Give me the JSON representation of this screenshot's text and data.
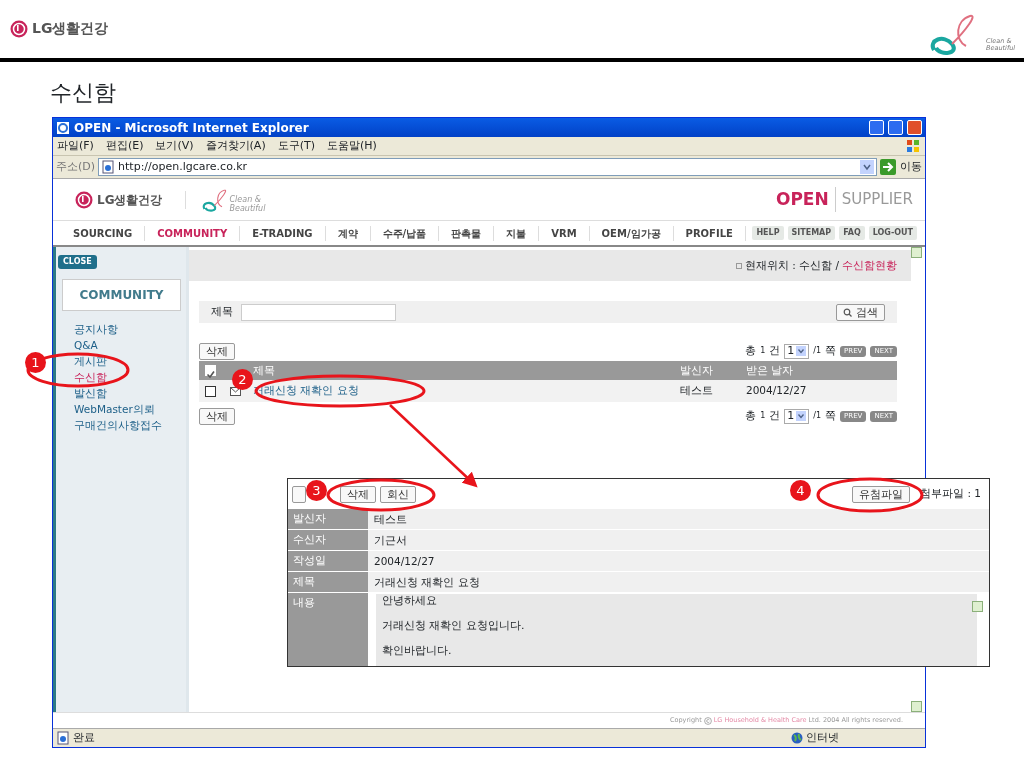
{
  "slide": {
    "brand": "LG생활건강",
    "tagline": [
      "Clean &",
      "Beautiful"
    ],
    "title": "수신함"
  },
  "browser": {
    "title": "OPEN - Microsoft Internet Explorer",
    "menu": [
      "파일(F)",
      "편집(E)",
      "보기(V)",
      "즐겨찾기(A)",
      "도구(T)",
      "도움말(H)"
    ],
    "address_label": "주소(D)",
    "url": "http://open.lgcare.co.kr",
    "go": "이동",
    "status": "완료",
    "zone": "인터넷"
  },
  "site": {
    "brand": "LG생활건강",
    "tagline": [
      "Clean &",
      "Beautiful"
    ],
    "product": "OPEN",
    "product_sub": "SUPPLIER",
    "nav": [
      {
        "label": "SOURCING",
        "selected": false
      },
      {
        "label": "COMMUNITY",
        "selected": true
      },
      {
        "label": "E-TRADING",
        "selected": false
      },
      {
        "label": "계약",
        "selected": false
      },
      {
        "label": "수주/납품",
        "selected": false
      },
      {
        "label": "판촉물",
        "selected": false
      },
      {
        "label": "지불",
        "selected": false
      },
      {
        "label": "VRM",
        "selected": false
      },
      {
        "label": "OEM/임가공",
        "selected": false
      },
      {
        "label": "PROFILE",
        "selected": false
      }
    ],
    "utility": [
      "HELP",
      "SITEMAP",
      "FAQ",
      "LOG-OUT"
    ],
    "close": "CLOSE",
    "sidebar_title": "COMMUNITY",
    "sidebar": [
      {
        "label": "공지사항",
        "selected": false
      },
      {
        "label": "Q&A",
        "selected": false
      },
      {
        "label": "게시판",
        "selected": false
      },
      {
        "label": "수신함",
        "selected": true
      },
      {
        "label": "발신함",
        "selected": false
      },
      {
        "label": "WebMaster의뢰",
        "selected": false
      },
      {
        "label": "구매건의사항접수",
        "selected": false
      }
    ],
    "breadcrumb": {
      "label": "현재위치 : 수신함 /",
      "current": "수신함현황"
    },
    "search": {
      "label": "제목",
      "button": "검색"
    },
    "delete_buttons": [
      "삭제",
      "삭제"
    ],
    "pagers": [
      {
        "total": "총",
        "count": "1",
        "unit": "건",
        "page": "1",
        "pages": "/1",
        "page_unit": "쪽",
        "prev": "PREV",
        "next": "NEXT"
      },
      {
        "total": "총",
        "count": "1",
        "unit": "건",
        "page": "1",
        "pages": "/1",
        "page_unit": "쪽",
        "prev": "PREV",
        "next": "NEXT"
      }
    ],
    "select_all": {
      "checked": true
    },
    "columns": [
      "제목",
      "발신자",
      "받은 날자"
    ],
    "rows": [
      {
        "checked": false,
        "subject": "거래신청 재확인 요청",
        "sender": "테스트",
        "date": "2004/12/27"
      }
    ],
    "copyright": [
      "Copyright",
      "LG Household & Health Care",
      "Ltd. 2004 All rights reserved."
    ]
  },
  "popup": {
    "buttons": [
      "삭제",
      "회신"
    ],
    "file_button": "유첨파일",
    "attachment": "첨부파일 : 1",
    "fields": [
      {
        "label": "발신자",
        "value": "테스트"
      },
      {
        "label": "수신자",
        "value": "기근서"
      },
      {
        "label": "작성일",
        "value": "2004/12/27"
      },
      {
        "label": "제목",
        "value": "거래신청 재확인 요청"
      }
    ],
    "content_label": "내용",
    "content": [
      "안녕하세요",
      "거래신청 재확인 요청입니다.",
      "확인바랍니다."
    ]
  },
  "callouts": [
    "1",
    "2",
    "3",
    "4"
  ]
}
